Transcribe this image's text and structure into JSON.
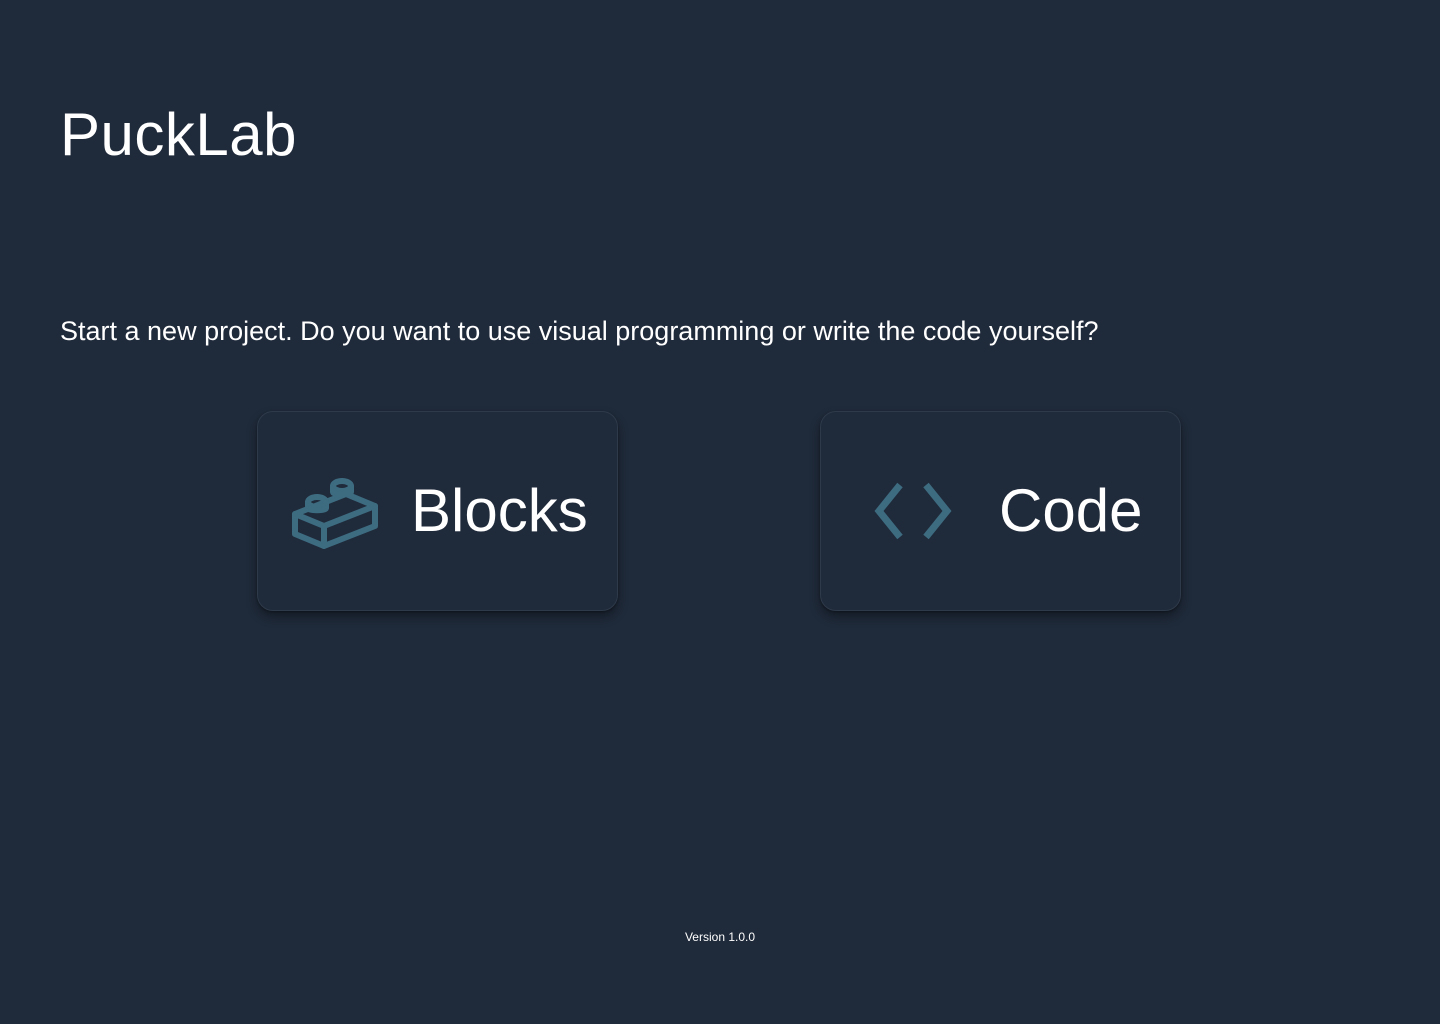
{
  "app": {
    "title": "PuckLab"
  },
  "main": {
    "prompt": "Start a new project. Do you want to use visual programming or write the code yourself?",
    "choices": [
      {
        "label": "Blocks",
        "icon": "lego-brick-icon"
      },
      {
        "label": "Code",
        "icon": "code-brackets-icon"
      }
    ]
  },
  "footer": {
    "version": "Version 1.0.0"
  },
  "colors": {
    "background": "#1f2a3a",
    "icon_accent": "#3d6b80",
    "text": "#ffffff"
  }
}
